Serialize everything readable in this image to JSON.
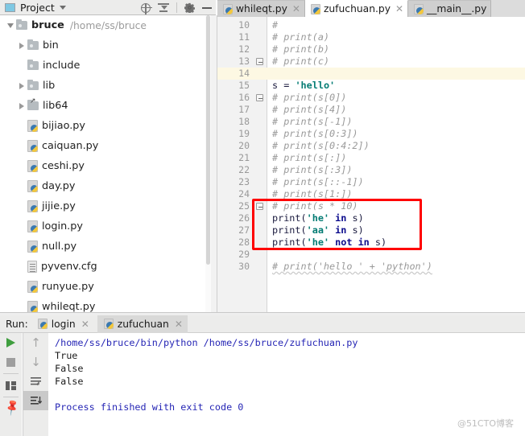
{
  "project_panel": {
    "title": "Project",
    "icons": [
      "target-icon",
      "collapse-all-icon",
      "gear-icon",
      "minimize-icon"
    ],
    "tree": [
      {
        "name": "bruce",
        "path": "/home/ss/bruce",
        "kind": "root",
        "indent": 0,
        "expanded": true,
        "bold": true
      },
      {
        "name": "bin",
        "path": "",
        "kind": "folder",
        "indent": 1,
        "expanded": false,
        "bold": false
      },
      {
        "name": "include",
        "path": "",
        "kind": "folder",
        "indent": 1,
        "expanded": null,
        "bold": false
      },
      {
        "name": "lib",
        "path": "",
        "kind": "folder",
        "indent": 1,
        "expanded": false,
        "bold": false
      },
      {
        "name": "lib64",
        "path": "",
        "kind": "folder-link",
        "indent": 1,
        "expanded": false,
        "bold": false
      },
      {
        "name": "bijiao.py",
        "path": "",
        "kind": "python",
        "indent": 1,
        "expanded": null,
        "bold": false
      },
      {
        "name": "caiquan.py",
        "path": "",
        "kind": "python",
        "indent": 1,
        "expanded": null,
        "bold": false
      },
      {
        "name": "ceshi.py",
        "path": "",
        "kind": "python",
        "indent": 1,
        "expanded": null,
        "bold": false
      },
      {
        "name": "day.py",
        "path": "",
        "kind": "python",
        "indent": 1,
        "expanded": null,
        "bold": false
      },
      {
        "name": "jijie.py",
        "path": "",
        "kind": "python",
        "indent": 1,
        "expanded": null,
        "bold": false
      },
      {
        "name": "login.py",
        "path": "",
        "kind": "python",
        "indent": 1,
        "expanded": null,
        "bold": false
      },
      {
        "name": "null.py",
        "path": "",
        "kind": "python",
        "indent": 1,
        "expanded": null,
        "bold": false
      },
      {
        "name": "pyvenv.cfg",
        "path": "",
        "kind": "config",
        "indent": 1,
        "expanded": null,
        "bold": false
      },
      {
        "name": "runyue.py",
        "path": "",
        "kind": "python",
        "indent": 1,
        "expanded": null,
        "bold": false
      },
      {
        "name": "whileqt.py",
        "path": "",
        "kind": "python",
        "indent": 1,
        "expanded": null,
        "bold": false
      }
    ]
  },
  "editor": {
    "tabs": [
      {
        "label": "whileqt.py",
        "active": false,
        "closable": true
      },
      {
        "label": "zufuchuan.py",
        "active": true,
        "closable": true
      },
      {
        "label": "__main__.py",
        "active": false,
        "closable": false
      }
    ],
    "highlighted_line": 14,
    "first_visible_line": 10,
    "lines": [
      {
        "n": 10,
        "tokens": [
          {
            "t": "#",
            "c": "cmt"
          }
        ],
        "fold": null
      },
      {
        "n": 11,
        "tokens": [
          {
            "t": "# print(a)",
            "c": "cmt"
          }
        ],
        "fold": null
      },
      {
        "n": 12,
        "tokens": [
          {
            "t": "# print(b)",
            "c": "cmt"
          }
        ],
        "fold": null
      },
      {
        "n": 13,
        "tokens": [
          {
            "t": "# print(c)",
            "c": "cmt"
          }
        ],
        "fold": "minus"
      },
      {
        "n": 14,
        "tokens": [
          {
            "t": "",
            "c": "pln"
          }
        ],
        "fold": null
      },
      {
        "n": 15,
        "tokens": [
          {
            "t": "s ",
            "c": "pln"
          },
          {
            "t": "= ",
            "c": "pln"
          },
          {
            "t": "'hello'",
            "c": "str"
          }
        ],
        "fold": null
      },
      {
        "n": 16,
        "tokens": [
          {
            "t": "# print(s[0])",
            "c": "cmt"
          }
        ],
        "fold": "minus"
      },
      {
        "n": 17,
        "tokens": [
          {
            "t": "# print(s[4])",
            "c": "cmt"
          }
        ],
        "fold": null
      },
      {
        "n": 18,
        "tokens": [
          {
            "t": "# print(s[-1])",
            "c": "cmt"
          }
        ],
        "fold": null
      },
      {
        "n": 19,
        "tokens": [
          {
            "t": "# print(s[0:3])",
            "c": "cmt"
          }
        ],
        "fold": null
      },
      {
        "n": 20,
        "tokens": [
          {
            "t": "# print(s[0:4:2])",
            "c": "cmt"
          }
        ],
        "fold": null
      },
      {
        "n": 21,
        "tokens": [
          {
            "t": "# print(s[:])",
            "c": "cmt"
          }
        ],
        "fold": null
      },
      {
        "n": 22,
        "tokens": [
          {
            "t": "# print(s[:3])",
            "c": "cmt"
          }
        ],
        "fold": null
      },
      {
        "n": 23,
        "tokens": [
          {
            "t": "# print(s[::-1])",
            "c": "cmt"
          }
        ],
        "fold": null
      },
      {
        "n": 24,
        "tokens": [
          {
            "t": "# print(s[1:])",
            "c": "cmt"
          }
        ],
        "fold": null
      },
      {
        "n": 25,
        "tokens": [
          {
            "t": "# print(s * 10)",
            "c": "cmt"
          }
        ],
        "fold": "minus"
      },
      {
        "n": 26,
        "tokens": [
          {
            "t": "print(",
            "c": "pln"
          },
          {
            "t": "'he'",
            "c": "str"
          },
          {
            "t": " ",
            "c": "pln"
          },
          {
            "t": "in",
            "c": "kw"
          },
          {
            "t": " s)",
            "c": "pln"
          }
        ],
        "fold": null
      },
      {
        "n": 27,
        "tokens": [
          {
            "t": "print(",
            "c": "pln"
          },
          {
            "t": "'aa'",
            "c": "str"
          },
          {
            "t": " ",
            "c": "pln"
          },
          {
            "t": "in",
            "c": "kw"
          },
          {
            "t": " s)",
            "c": "pln"
          }
        ],
        "fold": null
      },
      {
        "n": 28,
        "tokens": [
          {
            "t": "print(",
            "c": "pln"
          },
          {
            "t": "'he'",
            "c": "str"
          },
          {
            "t": " ",
            "c": "pln"
          },
          {
            "t": "not in",
            "c": "kw"
          },
          {
            "t": " s)",
            "c": "pln"
          }
        ],
        "fold": null
      },
      {
        "n": 29,
        "tokens": [
          {
            "t": "",
            "c": "pln"
          }
        ],
        "fold": null
      },
      {
        "n": 30,
        "tokens": [
          {
            "t": "# print('hello ' + 'python')",
            "c": "cmt"
          }
        ],
        "fold": null
      }
    ],
    "annotation": {
      "shape": "rectangle",
      "color": "#ff0000",
      "covers_lines": [
        25,
        26,
        27,
        28,
        29
      ]
    }
  },
  "run_panel": {
    "label": "Run:",
    "tabs": [
      {
        "label": "login",
        "active": false
      },
      {
        "label": "zufuchuan",
        "active": true
      }
    ],
    "toolbar": [
      {
        "name": "run-button",
        "icon": "play-icon"
      },
      {
        "name": "stop-button",
        "icon": "stop-icon"
      },
      {
        "name": "layout-button",
        "icon": "layout-icon"
      },
      {
        "name": "pin-button",
        "icon": "pin-icon"
      }
    ],
    "toolbar2": [
      {
        "name": "scroll-up-button",
        "icon": "arrow-up-icon"
      },
      {
        "name": "scroll-down-button",
        "icon": "arrow-down-icon"
      },
      {
        "name": "soft-wrap-button",
        "icon": "wrap-icon"
      },
      {
        "name": "scroll-to-end-button",
        "icon": "scroll-end-icon"
      }
    ],
    "console": [
      {
        "text": "/home/ss/bruce/bin/python /home/ss/bruce/zufuchuan.py",
        "color": "blue"
      },
      {
        "text": "True",
        "color": "black"
      },
      {
        "text": "False",
        "color": "black"
      },
      {
        "text": "False",
        "color": "black"
      },
      {
        "text": "",
        "color": "black"
      },
      {
        "text": "Process finished with exit code 0",
        "color": "blue"
      }
    ]
  },
  "watermark": "@51CTO博客",
  "colors": {
    "accent_red": "#ff0000",
    "string_green": "#047c74",
    "keyword_blue": "#0a0a8c",
    "comment_gray": "#9a9a9a",
    "console_blue": "#2626b5",
    "highlight_yellow": "#fdf8e3",
    "run_green": "#3f9e3f"
  }
}
